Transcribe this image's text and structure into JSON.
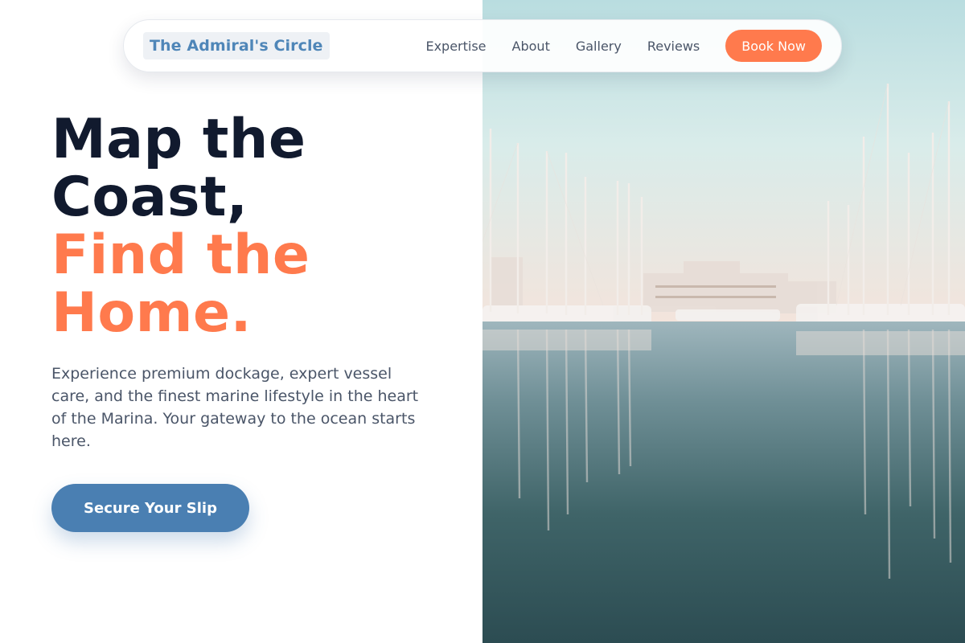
{
  "nav": {
    "brand": "The Admiral's Circle",
    "links": [
      "Expertise",
      "About",
      "Gallery",
      "Reviews"
    ],
    "cta": "Book Now"
  },
  "hero": {
    "headline_line1": "Map the",
    "headline_line2": "Coast,",
    "headline_accent1": "Find the",
    "headline_accent2": "Home.",
    "description": "Experience premium dockage, expert vessel care, and the finest marine lifestyle in the heart of the Marina. Your gateway to the ocean starts here.",
    "cta": "Secure Your Slip",
    "image": "marina-photo"
  },
  "colors": {
    "accent": "#ff7a4d",
    "primary": "#4a7fb2",
    "heading": "#111a2e",
    "body_text": "#4a5568",
    "brand": "#4f86b8"
  }
}
